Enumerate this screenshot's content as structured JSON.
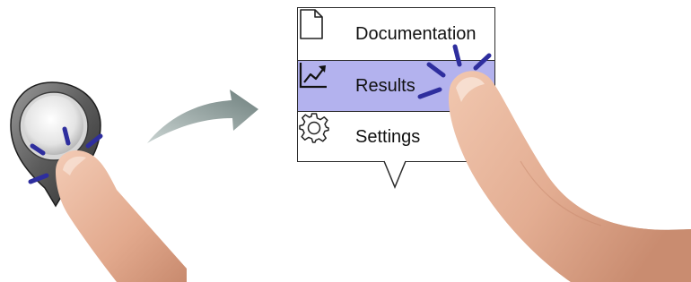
{
  "menu": {
    "items": [
      {
        "label": "Documentation",
        "icon": "document-icon",
        "selected": false
      },
      {
        "label": "Results",
        "icon": "chart-trend-icon",
        "selected": true
      },
      {
        "label": "Settings",
        "icon": "gear-icon",
        "selected": false
      }
    ],
    "highlight_color": "#b3b2ee"
  },
  "colors": {
    "tap_lines": "#2e2e9e",
    "arrow": "#8a9a98",
    "skin": "#e8b59a"
  }
}
